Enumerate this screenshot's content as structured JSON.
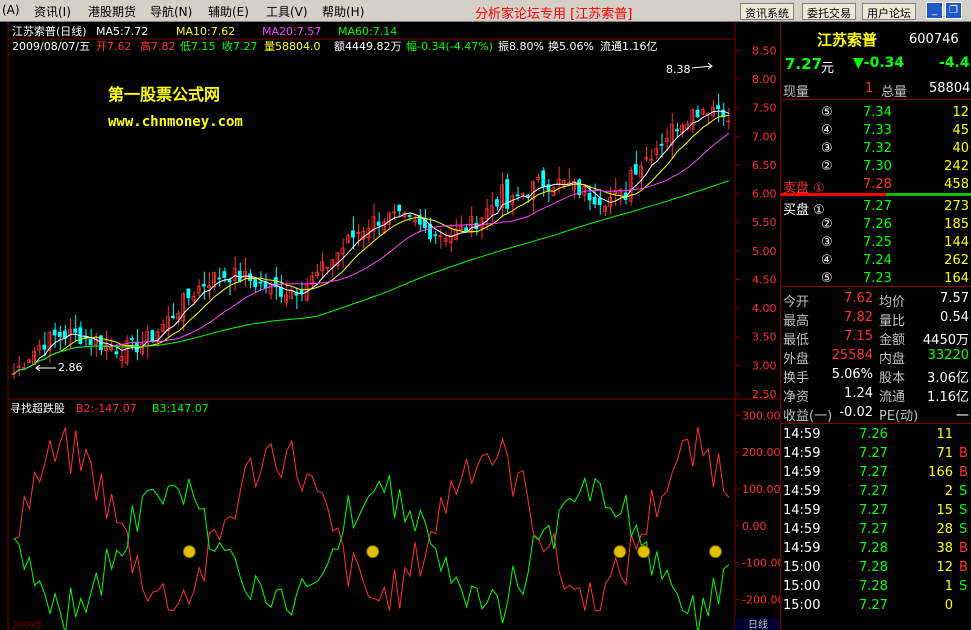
{
  "menubar": {
    "items": [
      "(A)",
      "资讯(I)",
      "港股期货",
      "导航(N)",
      "辅助(E)",
      "工具(V)",
      "帮助(H)"
    ],
    "title": "分析家论坛专用 [江苏索普]",
    "buttons": [
      "资讯系统",
      "委托交易",
      "用户论坛"
    ]
  },
  "chart": {
    "title_line": "江苏索普(日线)",
    "ma5": "MA5:7.72",
    "ma10": "MA10:7.62",
    "ma20": "MA20:7.57",
    "ma60": "MA60:7.14",
    "info": [
      "2009/08/07/五",
      "开7.62",
      "高7.82",
      "低7.15",
      "收7.27",
      "量58804.0",
      "额4449.82万",
      "幅-0.34(-4.47%)",
      "振8.80%",
      "换5.06%",
      "流通1.16亿"
    ],
    "watermark1": "第一股票公式网",
    "watermark2": "www.chnmoney.com",
    "high_marker": "8.38",
    "low_marker": "2.86",
    "price_ticks": [
      "8.50",
      "8.00",
      "7.50",
      "7.00",
      "6.50",
      "6.00",
      "5.50",
      "5.00",
      "4.50",
      "4.00",
      "3.50",
      "3.00",
      "2.50"
    ],
    "indicator_name": "寻找超跌股",
    "b2": "B2:-147.07",
    "b3": "B3:147.07",
    "ind_ticks": [
      "300.00",
      "200.00",
      "100.00",
      "0.00",
      "-100.00",
      "-200.00"
    ],
    "bottom_label": "日线",
    "date_label": "2009年"
  },
  "chart_data": {
    "type": "candlestick",
    "ylim": [
      2.5,
      8.7
    ],
    "ind_ylim": [
      -250,
      320
    ]
  },
  "quote": {
    "name": "江苏索普",
    "code": "600746",
    "price": "7.27",
    "unit": "元",
    "change": "▼-0.34",
    "pct": "-4.4",
    "now_label": "现量",
    "now_val": "1",
    "total_label": "总量",
    "total_val": "58804",
    "sell": [
      {
        "n": "⑤",
        "p": "7.34",
        "v": "12"
      },
      {
        "n": "④",
        "p": "7.33",
        "v": "45"
      },
      {
        "n": "③",
        "p": "7.32",
        "v": "40"
      },
      {
        "n": "②",
        "p": "7.30",
        "v": "242"
      },
      {
        "n": "卖盘 ①",
        "p": "7.28",
        "v": "458"
      }
    ],
    "buy": [
      {
        "n": "买盘 ①",
        "p": "7.27",
        "v": "273"
      },
      {
        "n": "②",
        "p": "7.26",
        "v": "185"
      },
      {
        "n": "③",
        "p": "7.25",
        "v": "144"
      },
      {
        "n": "④",
        "p": "7.24",
        "v": "262"
      },
      {
        "n": "⑤",
        "p": "7.23",
        "v": "164"
      }
    ],
    "stats": [
      [
        "今开",
        "7.62",
        "均价",
        "7.57"
      ],
      [
        "最高",
        "7.82",
        "量比",
        "0.54"
      ],
      [
        "最低",
        "7.15",
        "金额",
        "4450万"
      ],
      [
        "外盘",
        "25584",
        "内盘",
        "33220"
      ],
      [
        "换手",
        "5.06%",
        "股本",
        "3.06亿"
      ],
      [
        "净资",
        "1.24",
        "流通",
        "1.16亿"
      ],
      [
        "收益(一)",
        "-0.02",
        "PE(动)",
        "一"
      ]
    ],
    "ticks": [
      [
        "14:59",
        "7.26",
        "11",
        ""
      ],
      [
        "14:59",
        "7.27",
        "71",
        "B"
      ],
      [
        "14:59",
        "7.27",
        "166",
        "B"
      ],
      [
        "14:59",
        "7.27",
        "2",
        "S"
      ],
      [
        "14:59",
        "7.27",
        "15",
        "S"
      ],
      [
        "14:59",
        "7.27",
        "28",
        "S"
      ],
      [
        "14:59",
        "7.28",
        "38",
        "B"
      ],
      [
        "15:00",
        "7.28",
        "12",
        "B"
      ],
      [
        "15:00",
        "7.28",
        "1",
        "S"
      ],
      [
        "15:00",
        "7.27",
        "0",
        ""
      ]
    ]
  }
}
